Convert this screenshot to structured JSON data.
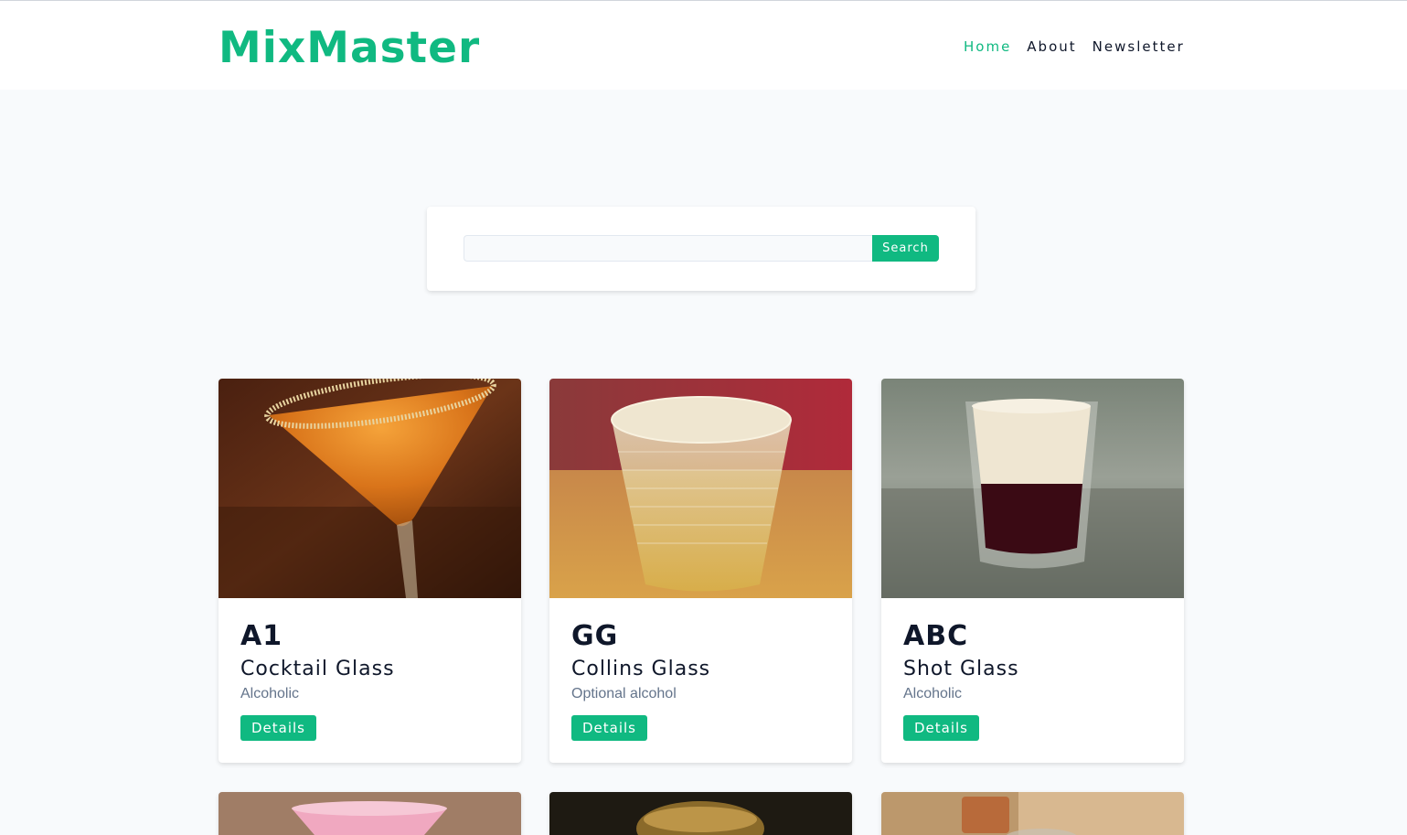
{
  "header": {
    "logo": "MixMaster",
    "nav": [
      {
        "label": "Home",
        "active": true
      },
      {
        "label": "About",
        "active": false
      },
      {
        "label": "Newsletter",
        "active": false
      }
    ]
  },
  "search": {
    "value": "",
    "placeholder": "",
    "button_label": "Search"
  },
  "colors": {
    "accent": "#10b981",
    "background": "#f8fafc",
    "text": "#0f172a",
    "muted": "#64748b"
  },
  "cocktails": [
    {
      "name": "A1",
      "glass": "Cocktail Glass",
      "type": "Alcoholic",
      "button_label": "Details",
      "image_icon": "cocktail-photo"
    },
    {
      "name": "GG",
      "glass": "Collins Glass",
      "type": "Optional alcohol",
      "button_label": "Details",
      "image_icon": "tumbler-photo"
    },
    {
      "name": "ABC",
      "glass": "Shot Glass",
      "type": "Alcoholic",
      "button_label": "Details",
      "image_icon": "shot-photo"
    }
  ]
}
